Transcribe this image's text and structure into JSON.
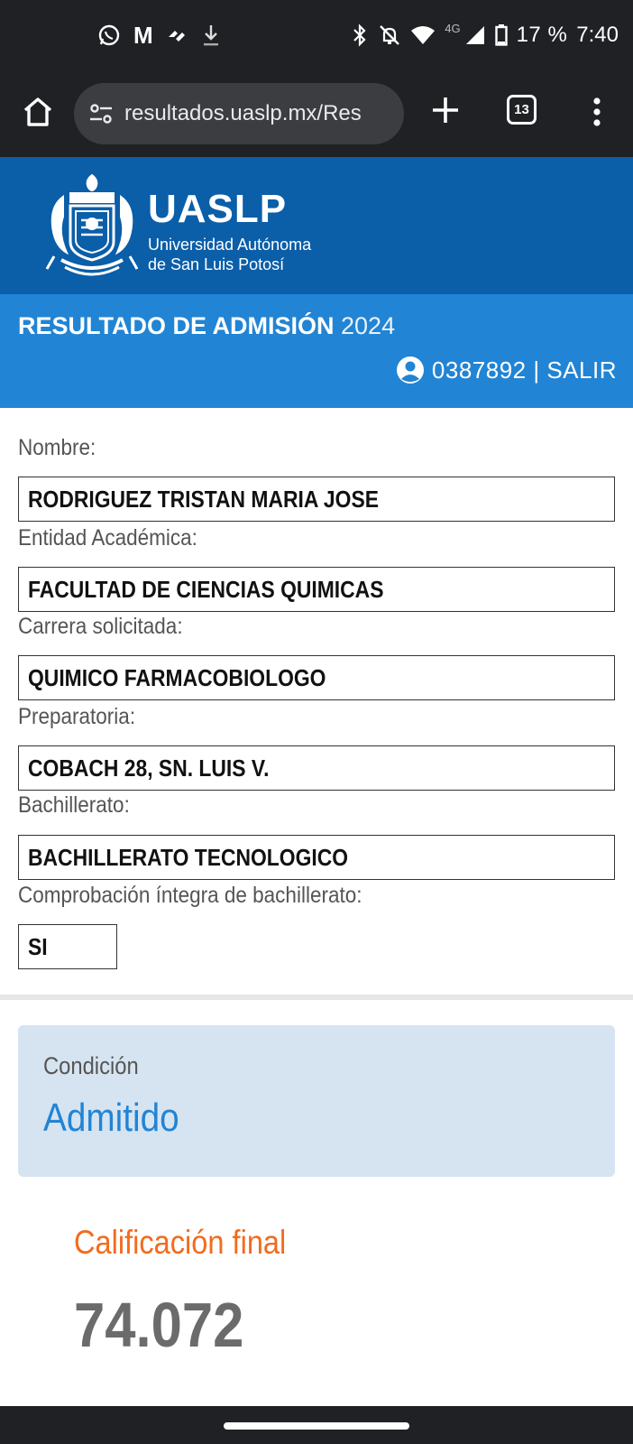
{
  "status_bar": {
    "left_icons": [
      "whatsapp-icon",
      "gmail-icon",
      "app-icon",
      "download-icon"
    ],
    "network_label": "4G",
    "battery_percent": "17 %",
    "time": "7:40"
  },
  "browser": {
    "url": "resultados.uaslp.mx/Res",
    "tab_count": "13"
  },
  "brand": {
    "name": "UASLP",
    "subtitle_line1": "Universidad Autónoma",
    "subtitle_line2": "de San Luis Potosí"
  },
  "title": {
    "main": "RESULTADO DE ADMISIÓN",
    "year": "2024"
  },
  "user": {
    "id_and_action": "0387892 | SALIR"
  },
  "fields": {
    "nombre": {
      "label": "Nombre:",
      "value": "RODRIGUEZ TRISTAN MARIA JOSE"
    },
    "entidad": {
      "label": "Entidad Académica:",
      "value": "FACULTAD DE CIENCIAS QUIMICAS"
    },
    "carrera": {
      "label": "Carrera solicitada:",
      "value": "QUIMICO FARMACOBIOLOGO"
    },
    "preparatoria": {
      "label": "Preparatoria:",
      "value": "COBACH 28, SN. LUIS V."
    },
    "bachillerato": {
      "label": "Bachillerato:",
      "value": "BACHILLERATO TECNOLOGICO"
    },
    "comprobacion": {
      "label": "Comprobación íntegra de bachillerato:",
      "value": "SI"
    }
  },
  "condition": {
    "label": "Condición",
    "value": "Admitido"
  },
  "grade": {
    "label": "Calificación final",
    "value": "74.072"
  },
  "colors": {
    "header_dark_blue": "#0b5ea8",
    "header_light_blue": "#2284d4",
    "condition_bg": "#d6e4f1",
    "grade_label": "#f26b1d"
  }
}
